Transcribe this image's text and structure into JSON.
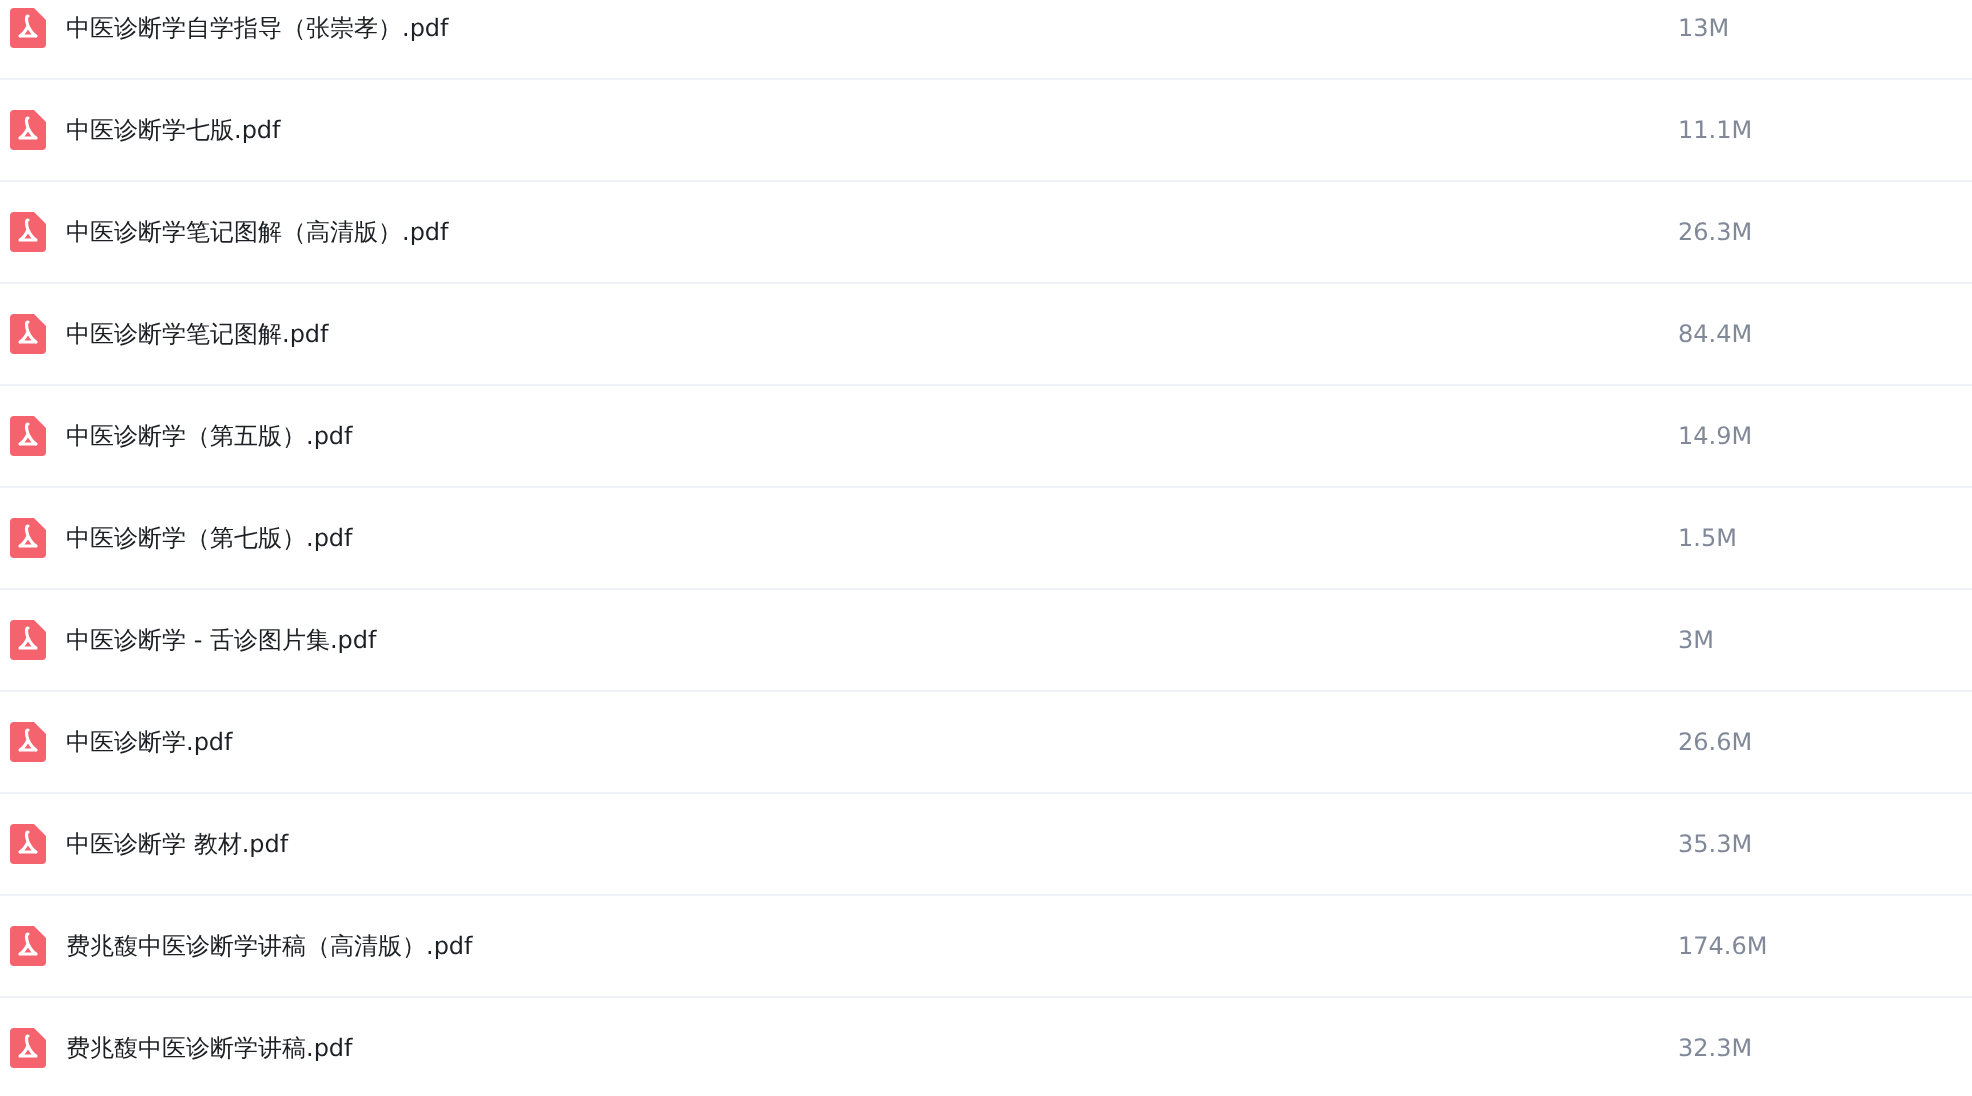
{
  "files": [
    {
      "name": "中医诊断学自学指导（张崇孝）.pdf",
      "size": "13M"
    },
    {
      "name": "中医诊断学七版.pdf",
      "size": "11.1M"
    },
    {
      "name": "中医诊断学笔记图解（高清版）.pdf",
      "size": "26.3M"
    },
    {
      "name": "中医诊断学笔记图解.pdf",
      "size": "84.4M"
    },
    {
      "name": "中医诊断学（第五版）.pdf",
      "size": "14.9M"
    },
    {
      "name": "中医诊断学（第七版）.pdf",
      "size": "1.5M"
    },
    {
      "name": "中医诊断学 - 舌诊图片集.pdf",
      "size": "3M"
    },
    {
      "name": "中医诊断学.pdf",
      "size": "26.6M"
    },
    {
      "name": "中医诊断学 教材.pdf",
      "size": "35.3M"
    },
    {
      "name": "费兆馥中医诊断学讲稿（高清版）.pdf",
      "size": "174.6M"
    },
    {
      "name": "费兆馥中医诊断学讲稿.pdf",
      "size": "32.3M"
    }
  ]
}
